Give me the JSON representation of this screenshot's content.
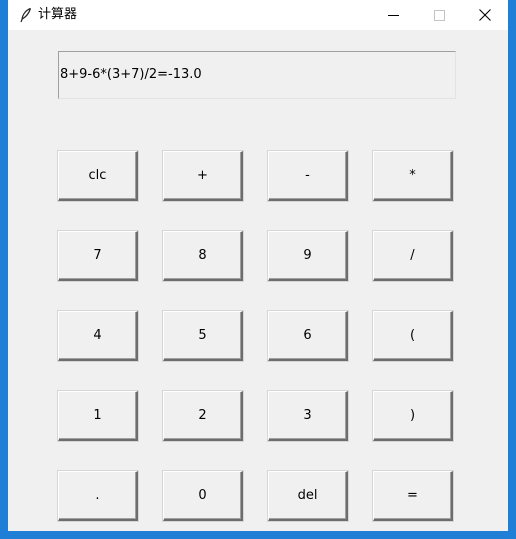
{
  "window": {
    "title": "计算器",
    "app_icon": "feather-icon",
    "controls": {
      "minimize_icon": "minimize-icon",
      "maximize_icon": "maximize-icon",
      "close_icon": "close-icon"
    }
  },
  "display": {
    "text": "8+9-6*(3+7)/2=-13.0"
  },
  "buttons": {
    "row1": [
      "clc",
      "+",
      "-",
      "*"
    ],
    "row2": [
      "7",
      "8",
      "9",
      "/"
    ],
    "row3": [
      "4",
      "5",
      "6",
      "("
    ],
    "row4": [
      "1",
      "2",
      "3",
      ")"
    ],
    "row5": [
      ".",
      "0",
      "del",
      "="
    ]
  },
  "colors": {
    "window_border": "#1f7fd6",
    "client_bg": "#f0f0f0",
    "titlebar_bg": "#ffffff"
  }
}
